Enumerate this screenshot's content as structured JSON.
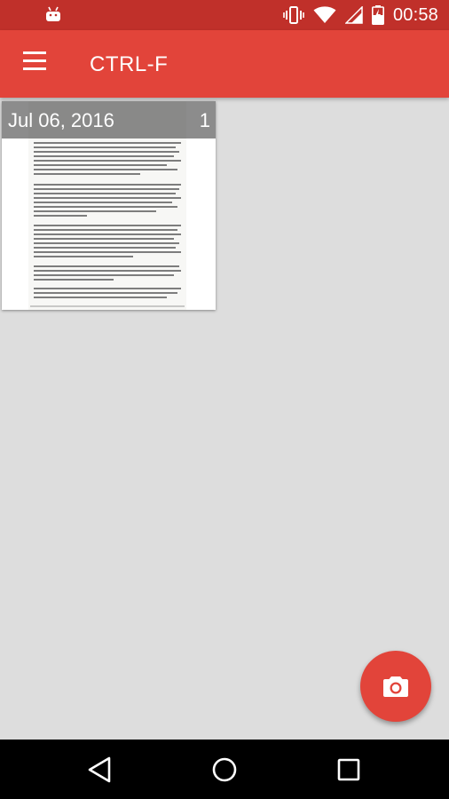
{
  "status_bar": {
    "time": "00:58",
    "icons": [
      "android-icon",
      "vibrate-icon",
      "wifi-icon",
      "signal-icon",
      "battery-charging-icon"
    ]
  },
  "app_bar": {
    "title": "CTRL-F",
    "menu_icon": "hamburger-menu-icon"
  },
  "documents": [
    {
      "date": "Jul 06, 2016",
      "page_count": "1"
    }
  ],
  "fab": {
    "icon": "camera-icon"
  },
  "nav_bar": {
    "icons": [
      "back-icon",
      "home-icon",
      "recents-icon"
    ]
  },
  "colors": {
    "status_bar": "#c0302a",
    "app_bar": "#e2443a",
    "accent": "#e2443a",
    "background": "#dddddd"
  }
}
